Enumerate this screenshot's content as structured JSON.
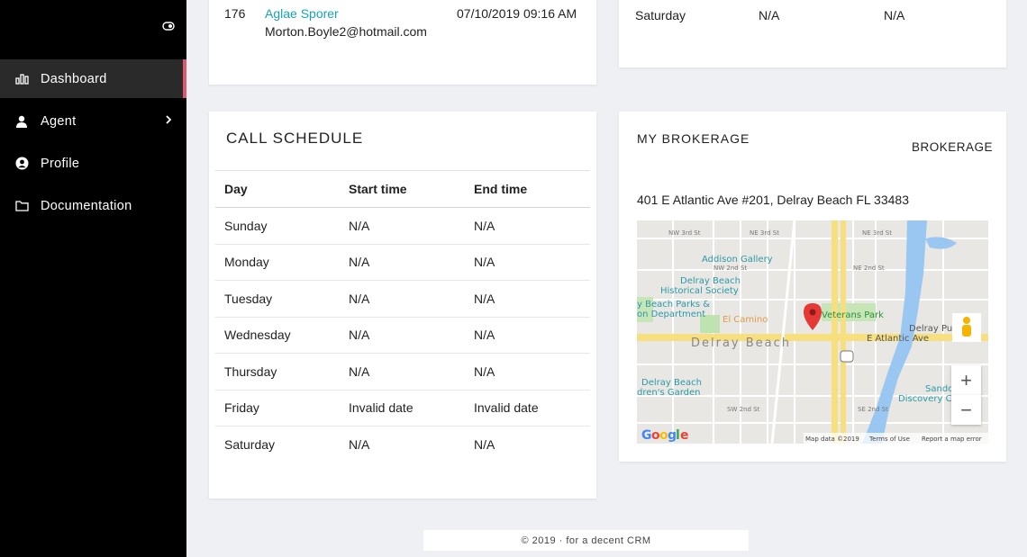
{
  "sidebar": {
    "items": [
      {
        "label": "Dashboard",
        "icon": "bar-chart-icon",
        "active": true
      },
      {
        "label": "Agent",
        "icon": "user-icon",
        "has_submenu": true
      },
      {
        "label": "Profile",
        "icon": "user-circle-icon"
      },
      {
        "label": "Documentation",
        "icon": "folder-icon"
      }
    ],
    "accent_color": "#e0566d"
  },
  "lead_card": {
    "id": "176",
    "name": "Aglae Sporer",
    "email": "Morton.Boyle2@hotmail.com",
    "datetime": "07/10/2019 09:16 AM"
  },
  "top_right_card": {
    "row": {
      "day": "Saturday",
      "start": "N/A",
      "end": "N/A"
    }
  },
  "call_schedule": {
    "title": "CALL SCHEDULE",
    "headers": [
      "Day",
      "Start time",
      "End time"
    ],
    "rows": [
      [
        "Sunday",
        "N/A",
        "N/A"
      ],
      [
        "Monday",
        "N/A",
        "N/A"
      ],
      [
        "Tuesday",
        "N/A",
        "N/A"
      ],
      [
        "Wednesday",
        "N/A",
        "N/A"
      ],
      [
        "Thursday",
        "N/A",
        "N/A"
      ],
      [
        "Friday",
        "Invalid date",
        "Invalid date"
      ],
      [
        "Saturday",
        "N/A",
        "N/A"
      ]
    ]
  },
  "brokerage": {
    "title": "MY BROKERAGE",
    "name": "BROKERAGE",
    "address": "401 E Atlantic Ave #201, Delray Beach FL 33483",
    "map": {
      "city_label": "Delray Beach",
      "street_label": "E Atlantic Ave",
      "places": [
        "Addison Gallery",
        "Delray Beach Historical Society",
        "Veterans Park",
        "El Camino",
        "Delray Beach Parks & Recreation Department",
        "Delray Beach Children's Garden",
        "Sandoway Discovery Center",
        "Delray Public"
      ],
      "google_logo": "Google",
      "map_data": "Map data ©2019",
      "terms": "Terms of Use",
      "report": "Report a map error",
      "zoom_in": "+",
      "zoom_out": "−"
    }
  },
  "footer": {
    "text": "© 2019 · for a decent CRM"
  }
}
